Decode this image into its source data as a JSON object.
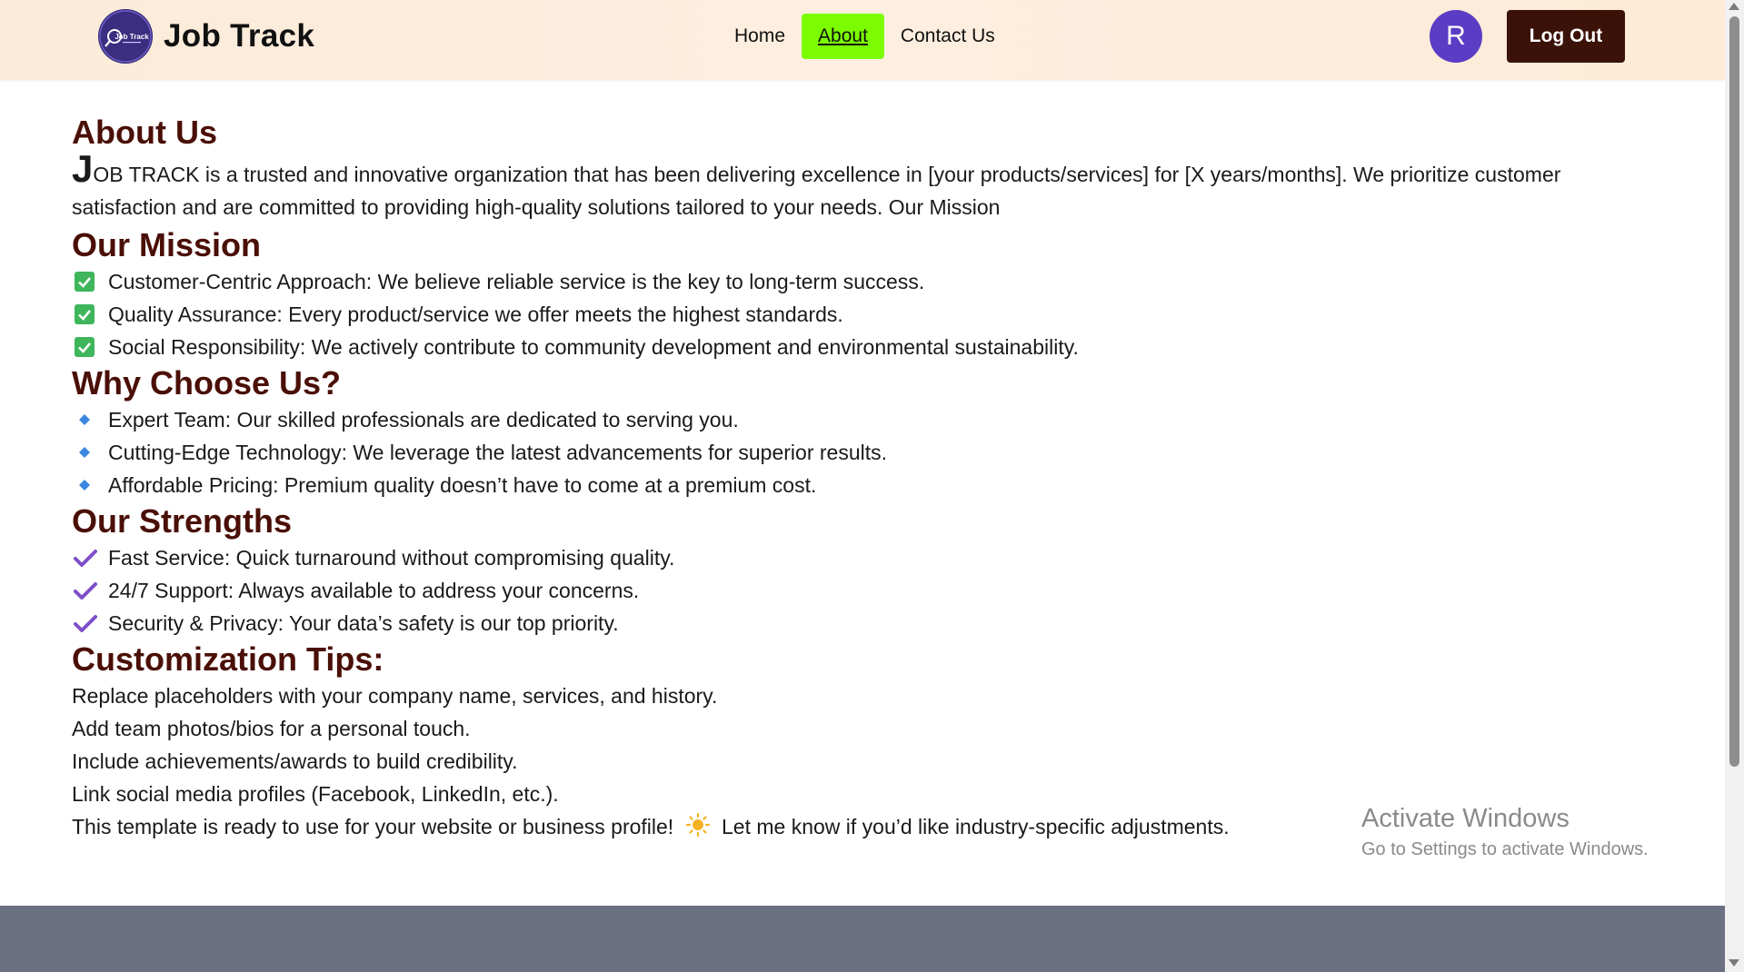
{
  "header": {
    "brand": "Job Track",
    "logo_text": "Job Track",
    "nav": [
      "Home",
      "About",
      "Contact Us"
    ],
    "active_nav": "About",
    "avatar_letter": "R",
    "logout_label": "Log Out"
  },
  "about": {
    "title": "About Us",
    "intro_drop": "J",
    "intro_rest": "OB TRACK is a trusted and innovative organization that has been delivering excellence in [your products/services] for [X years/months]. We prioritize customer satisfaction and are committed to providing high-quality solutions tailored to your needs. Our Mission"
  },
  "mission": {
    "title": "Our Mission",
    "icon": "green-checkbox-icon",
    "items": [
      "Customer-Centric Approach: We believe reliable service is the key to long-term success.",
      "Quality Assurance: Every product/service we offer meets the highest standards.",
      "Social Responsibility: We actively contribute to community development and environmental sustainability."
    ]
  },
  "why": {
    "title": "Why Choose Us?",
    "icon": "blue-diamond-icon",
    "items": [
      "Expert Team: Our skilled professionals are dedicated to serving you.",
      "Cutting-Edge Technology: We leverage the latest advancements for superior results.",
      "Affordable Pricing: Premium quality doesn’t have to come at a premium cost."
    ]
  },
  "strengths": {
    "title": "Our Strengths",
    "icon": "purple-checkmark-icon",
    "items": [
      "Fast Service: Quick turnaround without compromising quality.",
      "24/7 Support: Always available to address your concerns.",
      "Security & Privacy: Your data’s safety is our top priority."
    ]
  },
  "tips": {
    "title": "Customization Tips:",
    "lines": [
      "Replace placeholders with your company name, services, and history.",
      "Add team photos/bios for a personal touch.",
      "Include achievements/awards to build credibility.",
      "Link social media profiles (Facebook, LinkedIn, etc.)."
    ],
    "last_before": "This template is ready to use for your website or business profile!",
    "last_after": "Let me know if you’d like industry-specific adjustments."
  },
  "watermark": {
    "line1": "Activate Windows",
    "line2": "Go to Settings to activate Windows."
  },
  "colors": {
    "heading": "#4a0f06",
    "active_nav": "#7CFC00",
    "logout_bg": "#3b1208",
    "avatar_bg": "#5b3cc4",
    "footer_bg": "#6b7083"
  }
}
